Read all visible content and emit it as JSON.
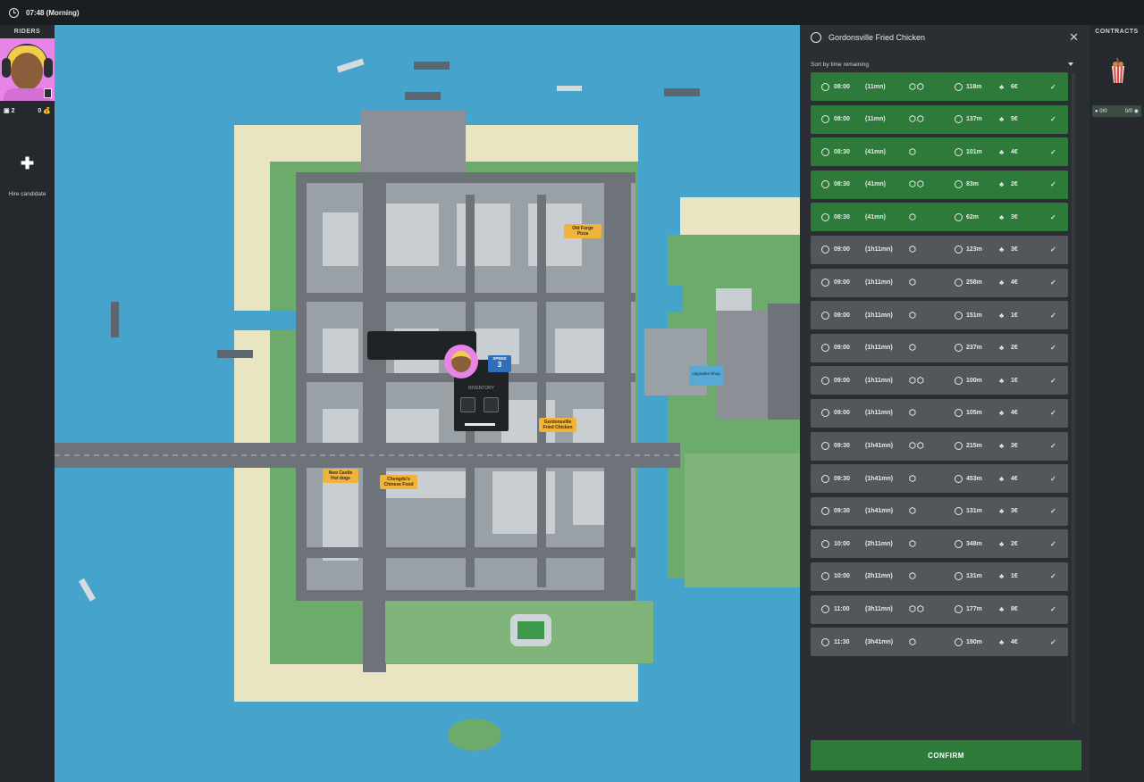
{
  "topbar": {
    "time": "07:48 (Morning)"
  },
  "riders": {
    "title": "RIDERS",
    "stat_left": "2",
    "stat_right": "0",
    "hire_label": "Hire candidate"
  },
  "contracts": {
    "title": "CONTRACTS",
    "badge_left": "0/0",
    "badge_right": "0/0"
  },
  "map": {
    "restaurants": [
      {
        "name": "Old Forge Pizza"
      },
      {
        "name": "Gordonsville Fried Chicken"
      },
      {
        "name": "New Castle Hot dogs"
      },
      {
        "name": "Chengdu's Chinese Food"
      },
      {
        "name": "Upgrades Shop"
      }
    ],
    "rider_popup": {
      "speed_label": "SPEED",
      "speed_value": "3",
      "inventory_label": "INVENTORY"
    }
  },
  "panel": {
    "title": "Gordonsville Fried Chicken",
    "sort_label": "Sort by time remaining",
    "confirm_label": "CONFIRM",
    "orders": [
      {
        "time": "08:00",
        "remaining": "(11mn)",
        "packages": 2,
        "distance": "118m",
        "price": "6€",
        "status": "green"
      },
      {
        "time": "08:00",
        "remaining": "(11mn)",
        "packages": 2,
        "distance": "137m",
        "price": "5€",
        "status": "green"
      },
      {
        "time": "08:30",
        "remaining": "(41mn)",
        "packages": 1,
        "distance": "101m",
        "price": "4€",
        "status": "green"
      },
      {
        "time": "08:30",
        "remaining": "(41mn)",
        "packages": 2,
        "distance": "83m",
        "price": "2€",
        "status": "green"
      },
      {
        "time": "08:30",
        "remaining": "(41mn)",
        "packages": 1,
        "distance": "62m",
        "price": "3€",
        "status": "green"
      },
      {
        "time": "09:00",
        "remaining": "(1h11mn)",
        "packages": 1,
        "distance": "123m",
        "price": "3€",
        "status": "grey"
      },
      {
        "time": "09:00",
        "remaining": "(1h11mn)",
        "packages": 1,
        "distance": "258m",
        "price": "4€",
        "status": "grey"
      },
      {
        "time": "09:00",
        "remaining": "(1h11mn)",
        "packages": 1,
        "distance": "151m",
        "price": "1€",
        "status": "grey"
      },
      {
        "time": "09:00",
        "remaining": "(1h11mn)",
        "packages": 1,
        "distance": "237m",
        "price": "2€",
        "status": "grey"
      },
      {
        "time": "09:00",
        "remaining": "(1h11mn)",
        "packages": 2,
        "distance": "100m",
        "price": "1€",
        "status": "grey"
      },
      {
        "time": "09:00",
        "remaining": "(1h11mn)",
        "packages": 1,
        "distance": "105m",
        "price": "4€",
        "status": "grey"
      },
      {
        "time": "09:30",
        "remaining": "(1h41mn)",
        "packages": 2,
        "distance": "215m",
        "price": "3€",
        "status": "grey"
      },
      {
        "time": "09:30",
        "remaining": "(1h41mn)",
        "packages": 1,
        "distance": "453m",
        "price": "4€",
        "status": "grey"
      },
      {
        "time": "09:30",
        "remaining": "(1h41mn)",
        "packages": 1,
        "distance": "131m",
        "price": "3€",
        "status": "grey"
      },
      {
        "time": "10:00",
        "remaining": "(2h11mn)",
        "packages": 1,
        "distance": "348m",
        "price": "2€",
        "status": "grey"
      },
      {
        "time": "10:00",
        "remaining": "(2h11mn)",
        "packages": 1,
        "distance": "131m",
        "price": "1€",
        "status": "grey"
      },
      {
        "time": "11:00",
        "remaining": "(3h11mn)",
        "packages": 2,
        "distance": "177m",
        "price": "8€",
        "status": "grey"
      },
      {
        "time": "11:30",
        "remaining": "(3h41mn)",
        "packages": 1,
        "distance": "190m",
        "price": "4€",
        "status": "grey"
      }
    ]
  },
  "colors": {
    "accent_green": "#2e7a3a",
    "row_grey": "#52575c",
    "water": "#45a3cc",
    "grass": "#6cab6c",
    "sand": "#e9e4c2",
    "road": "#6d7378",
    "rider_pink": "#e784e6"
  },
  "icons": {
    "clock": "clock-icon",
    "package": "package-icon",
    "pin": "location-pin-icon",
    "trophy": "trophy-icon",
    "check": "checkmark-icon",
    "close": "close-icon",
    "plus": "plus-icon"
  }
}
